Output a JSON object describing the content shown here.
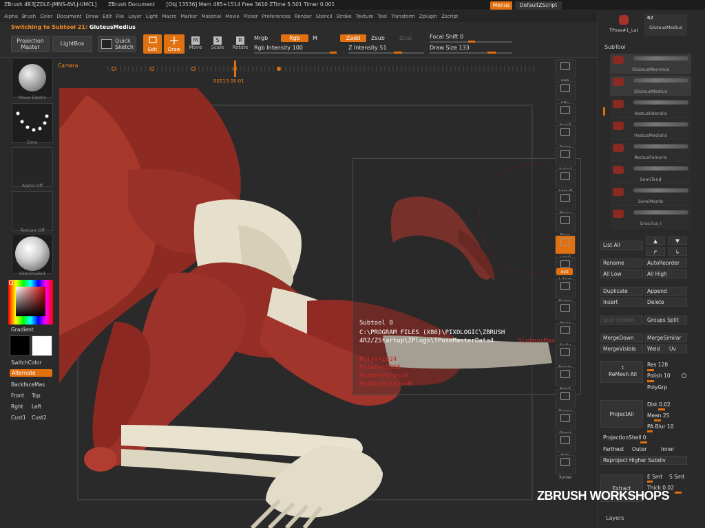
{
  "titlebar": {
    "app": "ZBrush 4R3[ZDLE-JMNS-AVLJ-UMCL]",
    "doc": "ZBrush Document",
    "stats": "[Obj 13536] Mem 485+1514 Free 3610 ZTime 5.501 Timer 0.001",
    "menus_btn": "Menus",
    "script_btn": "DefaultZScript"
  },
  "menubar": [
    "Alpha",
    "Brush",
    "Color",
    "Document",
    "Draw",
    "Edit",
    "File",
    "Layer",
    "Light",
    "Macro",
    "Marker",
    "Material",
    "Movie",
    "Picker",
    "Preferences",
    "Render",
    "Stencil",
    "Stroke",
    "Texture",
    "Tool",
    "Transform",
    "Zplugin",
    "Zscript"
  ],
  "status": {
    "prefix": "Switching to Subtool 21:",
    "name": "GluteusMedius"
  },
  "toolbar": {
    "projection_master": "Projection Master",
    "lightbox": "LightBox",
    "quick_sketch": "Quick Sketch",
    "edit": "Edit",
    "draw": "Draw",
    "move": "Move",
    "scale": "Scale",
    "rotate": "Rotate",
    "mrgb": "Mrgb",
    "rgb": "Rgb",
    "m": "M",
    "rgb_intensity_label": "Rgb Intensity",
    "rgb_intensity": "100",
    "zadd": "Zadd",
    "zsub": "Zsub",
    "zcut": "Zcut",
    "z_intensity_label": "Z Intensity",
    "z_intensity": "51",
    "focal_shift_label": "Focal Shift",
    "focal_shift": "0",
    "draw_size_label": "Draw Size",
    "draw_size": "133"
  },
  "left": {
    "brush_lbl": "Move Elastic",
    "stroke_lbl": "Dots",
    "alpha_lbl": "Alpha Off",
    "texture_lbl": "Texture Off",
    "material_lbl": "SkinShade4",
    "gradient": "Gradient",
    "switchcolor": "SwitchColor",
    "alternate": "Alternate",
    "backfacemask": "BackfaceMas",
    "front": "Front",
    "top": "Top",
    "right": "Rght",
    "left": "Left",
    "cust1": "Cust1",
    "cust2": "Cust2"
  },
  "timeline": {
    "camera": "Camera",
    "frame_a": "00213",
    "frame_b": "00:01"
  },
  "righttools": [
    "BPR",
    "SPix",
    "Scroll",
    "Zoom",
    "Actual",
    "AAHalf",
    "Persp",
    "Floor",
    "Local",
    "L.Sym",
    "Frame",
    "Move",
    "Scale",
    "Rotate",
    "PolyF",
    "Transp",
    "Ghost",
    "Solo",
    "Xpose"
  ],
  "xyz_label": "xyz",
  "info": {
    "line1": "Subtool 0",
    "line2": "C:\\PROGRAM FILES (X86)\\PIXOLOGIC\\ZBRUSH",
    "line3": "4R2/ZStartup\\ZPlugs\\TPoseMasterData4",
    "overlap": "GluteusMaximus",
    "polys": "Polys=1824",
    "points": "Points=1858",
    "hidden_polys": "HiddenPolys=0",
    "hidden_points": "HiddenPoints=0"
  },
  "panel": {
    "top_num": "62",
    "tool1": "TPose#1_Lat",
    "tool2": "GluteusMedius",
    "subtool_header": "SubTool",
    "subtools": [
      "GluteusMaximus",
      "GluteusMedius",
      "Vastuslateralis",
      "VastusMedialis",
      "RectusFemoris",
      "SemiTend",
      "SemiMemb",
      "Gracilus_I"
    ],
    "list_all": "List All",
    "rename": "Rename",
    "autoreorder": "AutoReorder",
    "all_low": "All Low",
    "all_high": "All High",
    "duplicate": "Duplicate",
    "append": "Append",
    "insert": "Insert",
    "delete": "Delete",
    "split_hidden": "Split Hidden",
    "groups_split": "Groups Split",
    "mergedown": "MergeDown",
    "mergesimilar": "MergeSimilar",
    "mergevisible": "MergeVisible",
    "weld": "Weld",
    "uv": "Uv",
    "remesh_all": "ReMesh All",
    "res_label": "Res",
    "res": "128",
    "polish_label": "Polish",
    "polish": "10",
    "polygrp": "PolyGrp",
    "projectall": "ProjectAll",
    "dist_label": "Dist",
    "dist": "0.02",
    "mean_label": "Mean",
    "mean": "25",
    "pa_blur_label": "PA Blur",
    "pa_blur": "10",
    "projectionshell_label": "ProjectionShell",
    "projectionshell": "0",
    "farthest": "Farthest",
    "outer": "Outer",
    "inner": "Inner",
    "reproject": "Reproject Higher Subdiv",
    "extract": "Extract",
    "e_smt": "E Smt",
    "s_smt": "S Smt",
    "thick_label": "Thick",
    "thick": "0.02",
    "layers": "Layers"
  },
  "watermark": "ZBRUSH WORKSHOPS",
  "colors": {
    "accent": "#e07010",
    "muscle": "#8a2a22",
    "bone": "#e8e2cf"
  }
}
